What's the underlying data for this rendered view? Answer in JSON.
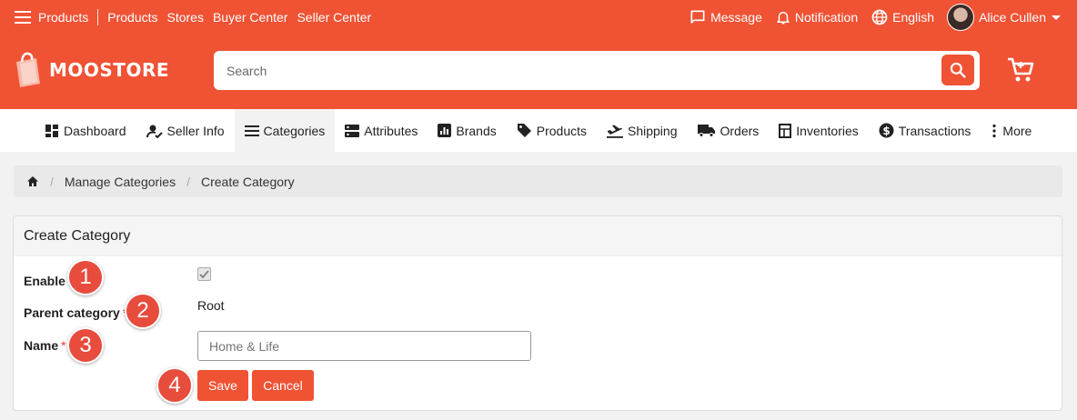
{
  "colors": {
    "brand": "#f05234",
    "badge": "#e74c3c"
  },
  "topnav": {
    "menu_icon": "hamburger-icon",
    "links": [
      "Products",
      "Products",
      "Stores",
      "Buyer Center",
      "Seller Center"
    ]
  },
  "topright": {
    "message": "Message",
    "notification": "Notification",
    "language": "English",
    "user": "Alice Cullen"
  },
  "brand": {
    "name": "MOOSTORE"
  },
  "search": {
    "placeholder": "Search"
  },
  "menu": {
    "items": [
      {
        "label": "Dashboard",
        "icon": "dashboard-icon"
      },
      {
        "label": "Seller Info",
        "icon": "seller-info-icon"
      },
      {
        "label": "Categories",
        "icon": "list-icon",
        "active": true
      },
      {
        "label": "Attributes",
        "icon": "attributes-icon"
      },
      {
        "label": "Brands",
        "icon": "brands-icon"
      },
      {
        "label": "Products",
        "icon": "tag-icon"
      },
      {
        "label": "Shipping",
        "icon": "shipping-icon"
      },
      {
        "label": "Orders",
        "icon": "truck-icon"
      },
      {
        "label": "Inventories",
        "icon": "inventory-icon"
      },
      {
        "label": "Transactions",
        "icon": "dollar-icon"
      },
      {
        "label": "More",
        "icon": "more-vert-icon"
      }
    ]
  },
  "breadcrumb": {
    "home_icon": "home-icon",
    "items": [
      "Manage Categories",
      "Create Category"
    ]
  },
  "form": {
    "title": "Create Category",
    "enable_label": "Enable",
    "enable_checked": true,
    "parent_label": "Parent category",
    "parent_value": "Root",
    "name_label": "Name",
    "name_placeholder": "Home & Life",
    "required_mark": "*",
    "save": "Save",
    "cancel": "Cancel"
  },
  "badges": [
    "1",
    "2",
    "3",
    "4"
  ]
}
